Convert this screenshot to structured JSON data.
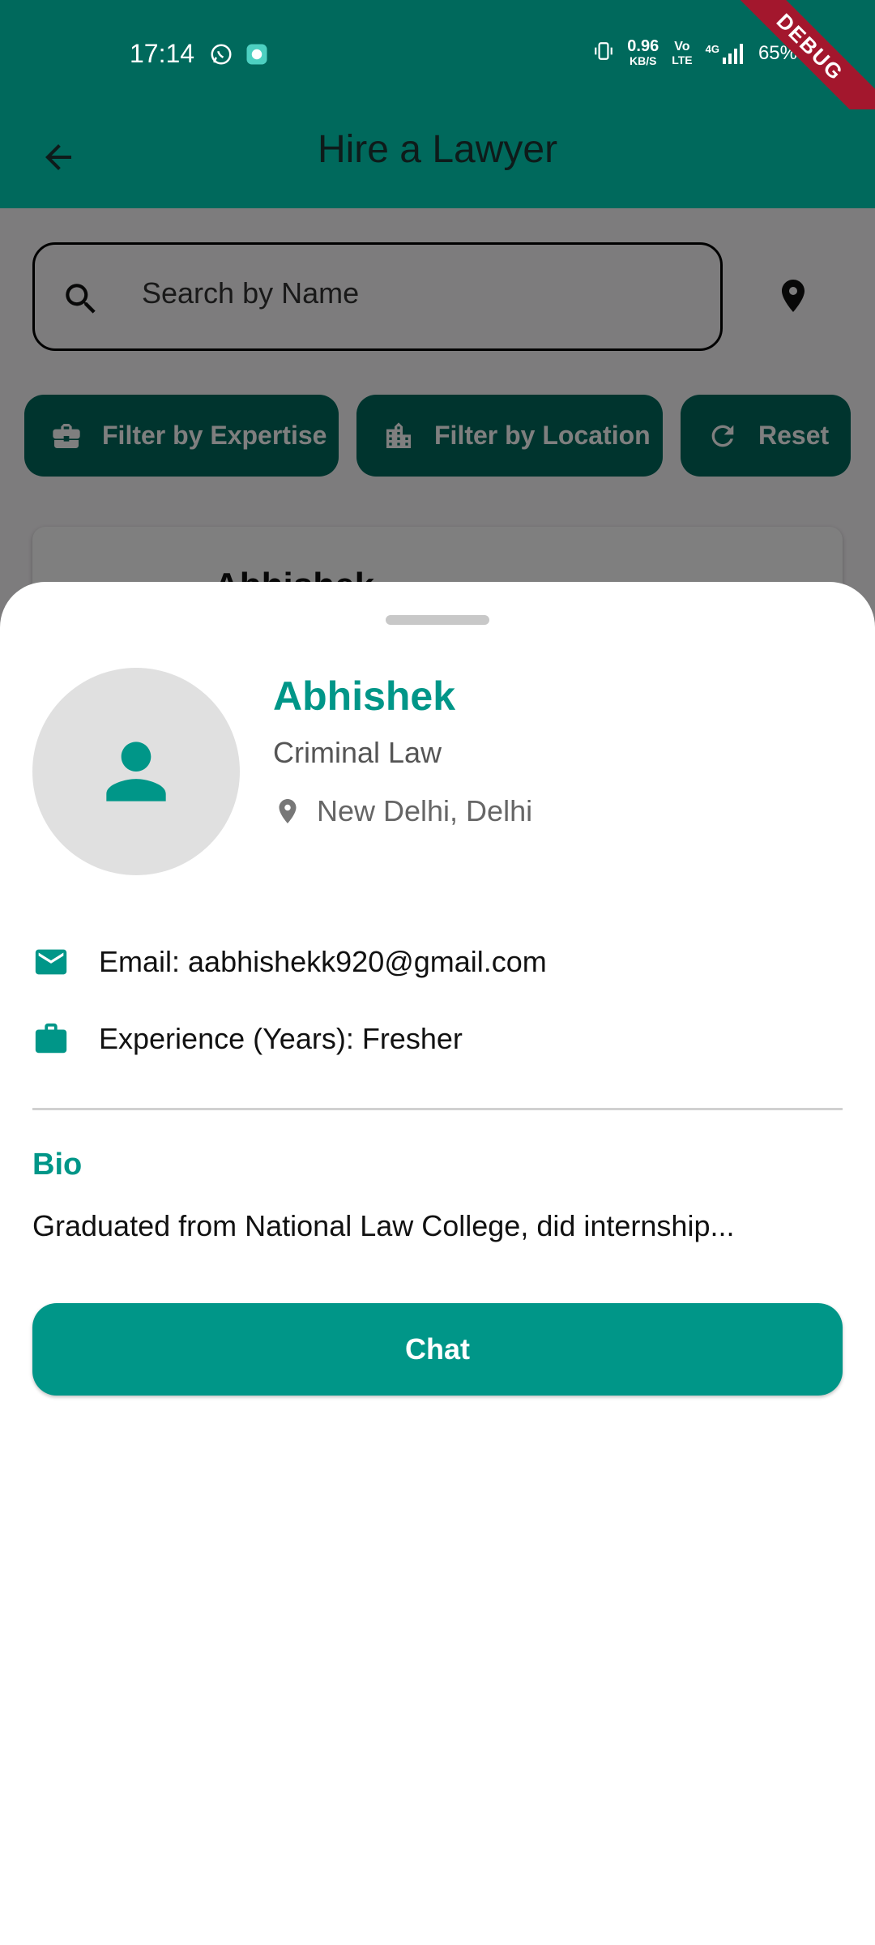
{
  "status_bar": {
    "time": "17:14",
    "net_speed_value": "0.96",
    "net_speed_unit": "KB/S",
    "volte_top": "Vo",
    "volte_bottom": "LTE",
    "signal_label": "4G",
    "battery": "65%",
    "icons": [
      "whatsapp-icon",
      "app-notification-icon",
      "vibrate-icon",
      "signal-icon",
      "battery-charging-icon"
    ]
  },
  "app_bar": {
    "title": "Hire a Lawyer",
    "back_icon": "arrow-back-icon"
  },
  "debug_banner": "DEBUG",
  "search": {
    "placeholder": "Search by Name",
    "value": ""
  },
  "filters": [
    {
      "label": "Filter by Expertise",
      "icon": "briefcase-icon"
    },
    {
      "label": "Filter by Location",
      "icon": "city-icon"
    },
    {
      "label": "Reset",
      "icon": "refresh-icon"
    }
  ],
  "background_card": {
    "name": "Abhishek"
  },
  "lawyer": {
    "name": "Abhishek",
    "specialty": "Criminal Law",
    "location": "New Delhi, Delhi",
    "email_line": "Email: aabhishekk920@gmail.com",
    "experience_line": "Experience (Years): Fresher",
    "bio_heading": "Bio",
    "bio": "Graduated from National Law College, did internship..."
  },
  "actions": {
    "chat_label": "Chat"
  },
  "colors": {
    "primary_dark": "#00695c",
    "accent": "#009688",
    "debug_banner": "#a3172d"
  }
}
